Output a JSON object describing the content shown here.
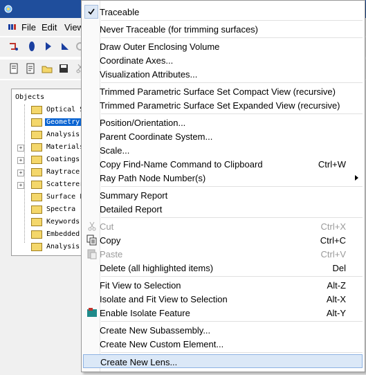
{
  "menubar": {
    "file": "File",
    "edit": "Edit",
    "view": "View"
  },
  "tree": {
    "header": "Objects",
    "items": [
      {
        "label": "Optical S",
        "expander": "",
        "selected": false
      },
      {
        "label": "Geometry",
        "expander": "",
        "selected": true
      },
      {
        "label": "Analysis",
        "expander": "",
        "selected": false
      },
      {
        "label": "Materials",
        "expander": "+",
        "selected": false
      },
      {
        "label": "Coatings",
        "expander": "+",
        "selected": false
      },
      {
        "label": "Raytrace",
        "expander": "+",
        "selected": false
      },
      {
        "label": "Scatterer",
        "expander": "+",
        "selected": false
      },
      {
        "label": "Surface F",
        "expander": "",
        "selected": false
      },
      {
        "label": "Spectra",
        "expander": "",
        "selected": false
      },
      {
        "label": "Keywords",
        "expander": "",
        "selected": false
      },
      {
        "label": "Embedded",
        "expander": "",
        "selected": false
      },
      {
        "label": "Analysis",
        "expander": "",
        "selected": false
      }
    ]
  },
  "menu": {
    "traceable": "Traceable",
    "never_traceable": "Never Traceable (for trimming surfaces)",
    "draw_outer": "Draw Outer Enclosing Volume",
    "coordinate_axes": "Coordinate Axes...",
    "visualization": "Visualization Attributes...",
    "compact_view": "Trimmed Parametric Surface Set Compact View (recursive)",
    "expanded_view": "Trimmed Parametric Surface Set Expanded View (recursive)",
    "position": "Position/Orientation...",
    "parent_cs": "Parent Coordinate System...",
    "scale": "Scale...",
    "copy_find": "Copy Find-Name Command to Clipboard",
    "copy_find_sc": "Ctrl+W",
    "ray_path": "Ray Path Node Number(s)",
    "summary": "Summary Report",
    "detailed": "Detailed Report",
    "cut": "Cut",
    "cut_sc": "Ctrl+X",
    "copy": "Copy",
    "copy_sc": "Ctrl+C",
    "paste": "Paste",
    "paste_sc": "Ctrl+V",
    "delete": "Delete (all highlighted items)",
    "delete_sc": "Del",
    "fit_view": "Fit View to Selection",
    "fit_view_sc": "Alt-Z",
    "isolate_fit": "Isolate and Fit View to Selection",
    "isolate_fit_sc": "Alt-X",
    "enable_isolate": "Enable Isolate Feature",
    "enable_isolate_sc": "Alt-Y",
    "new_subassembly": "Create New Subassembly...",
    "new_custom": "Create New Custom Element...",
    "new_lens": "Create New Lens..."
  },
  "colors": {
    "highlight": "#dbe8f7",
    "titlebar": "#1f4e9c",
    "selection": "#0a64d2"
  }
}
